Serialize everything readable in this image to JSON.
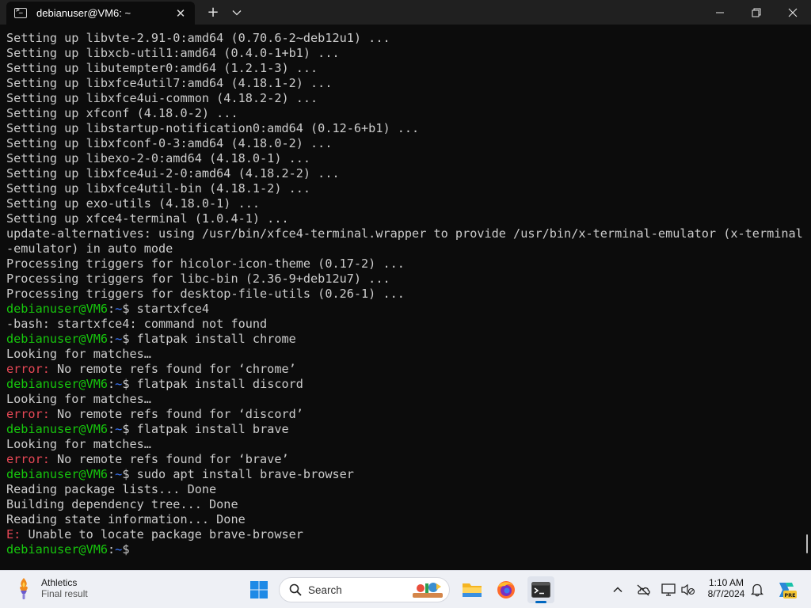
{
  "window": {
    "tab_title": "debianuser@VM6: ~",
    "tab_close_glyph": "✕",
    "new_tab_glyph": "+",
    "dropdown_glyph": "⌄"
  },
  "terminal": {
    "colors": {
      "background": "#0c0c0c",
      "text": "#cccccc",
      "prompt_user": "#16c60c",
      "prompt_path": "#3b78ff",
      "error": "#e74856"
    },
    "lines": [
      {
        "type": "out",
        "text": "Setting up libvte-2.91-0:amd64 (0.70.6-2~deb12u1) ..."
      },
      {
        "type": "out",
        "text": "Setting up libxcb-util1:amd64 (0.4.0-1+b1) ..."
      },
      {
        "type": "out",
        "text": "Setting up libutempter0:amd64 (1.2.1-3) ..."
      },
      {
        "type": "out",
        "text": "Setting up libxfce4util7:amd64 (4.18.1-2) ..."
      },
      {
        "type": "out",
        "text": "Setting up libxfce4ui-common (4.18.2-2) ..."
      },
      {
        "type": "out",
        "text": "Setting up xfconf (4.18.0-2) ..."
      },
      {
        "type": "out",
        "text": "Setting up libstartup-notification0:amd64 (0.12-6+b1) ..."
      },
      {
        "type": "out",
        "text": "Setting up libxfconf-0-3:amd64 (4.18.0-2) ..."
      },
      {
        "type": "out",
        "text": "Setting up libexo-2-0:amd64 (4.18.0-1) ..."
      },
      {
        "type": "out",
        "text": "Setting up libxfce4ui-2-0:amd64 (4.18.2-2) ..."
      },
      {
        "type": "out",
        "text": "Setting up libxfce4util-bin (4.18.1-2) ..."
      },
      {
        "type": "out",
        "text": "Setting up exo-utils (4.18.0-1) ..."
      },
      {
        "type": "out",
        "text": "Setting up xfce4-terminal (1.0.4-1) ..."
      },
      {
        "type": "out",
        "text": "update-alternatives: using /usr/bin/xfce4-terminal.wrapper to provide /usr/bin/x-terminal-emulator (x-terminal"
      },
      {
        "type": "out",
        "text": "-emulator) in auto mode"
      },
      {
        "type": "out",
        "text": "Processing triggers for hicolor-icon-theme (0.17-2) ..."
      },
      {
        "type": "out",
        "text": "Processing triggers for libc-bin (2.36-9+deb12u7) ..."
      },
      {
        "type": "out",
        "text": "Processing triggers for desktop-file-utils (0.26-1) ..."
      },
      {
        "type": "prompt",
        "user": "debianuser@VM6",
        "sep": ":",
        "path": "~",
        "symbol": "$ ",
        "cmd": "startxfce4"
      },
      {
        "type": "out",
        "text": "-bash: startxfce4: command not found"
      },
      {
        "type": "prompt",
        "user": "debianuser@VM6",
        "sep": ":",
        "path": "~",
        "symbol": "$ ",
        "cmd": "flatpak install chrome"
      },
      {
        "type": "out",
        "text": "Looking for matches…"
      },
      {
        "type": "error",
        "label": "error:",
        "text": " No remote refs found for ‘chrome’"
      },
      {
        "type": "prompt",
        "user": "debianuser@VM6",
        "sep": ":",
        "path": "~",
        "symbol": "$ ",
        "cmd": "flatpak install discord"
      },
      {
        "type": "out",
        "text": "Looking for matches…"
      },
      {
        "type": "error",
        "label": "error:",
        "text": " No remote refs found for ‘discord’"
      },
      {
        "type": "prompt",
        "user": "debianuser@VM6",
        "sep": ":",
        "path": "~",
        "symbol": "$ ",
        "cmd": "flatpak install brave"
      },
      {
        "type": "out",
        "text": "Looking for matches…"
      },
      {
        "type": "error",
        "label": "error:",
        "text": " No remote refs found for ‘brave’"
      },
      {
        "type": "prompt",
        "user": "debianuser@VM6",
        "sep": ":",
        "path": "~",
        "symbol": "$ ",
        "cmd": "sudo apt install brave-browser"
      },
      {
        "type": "out",
        "text": "Reading package lists... Done"
      },
      {
        "type": "out",
        "text": "Building dependency tree... Done"
      },
      {
        "type": "out",
        "text": "Reading state information... Done"
      },
      {
        "type": "error",
        "label": "E:",
        "text": " Unable to locate package brave-browser"
      },
      {
        "type": "prompt",
        "user": "debianuser@VM6",
        "sep": ":",
        "path": "~",
        "symbol": "$ ",
        "cmd": ""
      }
    ]
  },
  "taskbar": {
    "widget": {
      "title": "Athletics",
      "subtitle": "Final result",
      "icon": "torch-icon"
    },
    "search_placeholder": "Search",
    "apps": [
      {
        "name": "start-button",
        "icon": "windows-logo-icon"
      },
      {
        "name": "file-explorer",
        "icon": "folder-icon"
      },
      {
        "name": "firefox",
        "icon": "firefox-icon"
      },
      {
        "name": "terminal",
        "icon": "terminal-icon",
        "active": true
      }
    ],
    "tray": [
      "chevron-up-icon",
      "onedrive-icon",
      "display-icon",
      "volume-muted-icon"
    ],
    "clock": {
      "time": "1:10 AM",
      "date": "8/7/2024"
    },
    "copilot_badge": "PRE"
  }
}
